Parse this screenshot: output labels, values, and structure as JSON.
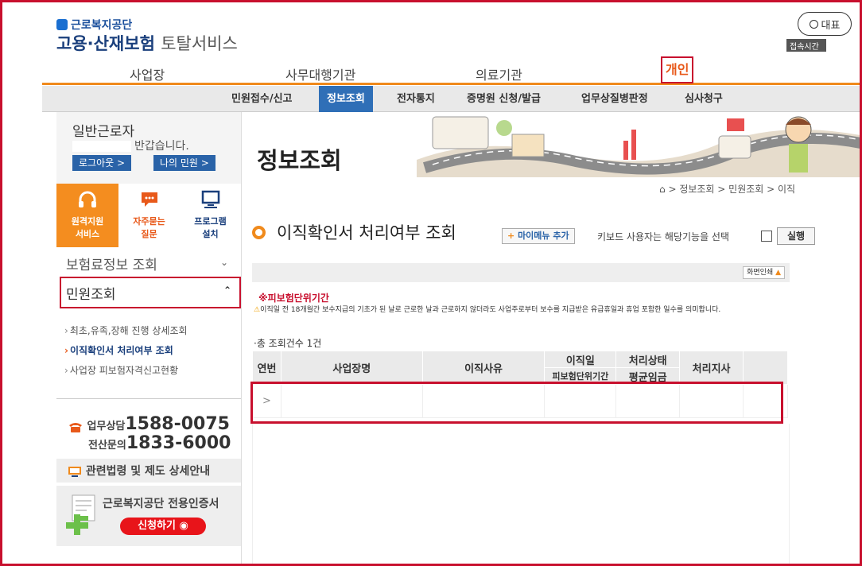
{
  "header": {
    "org_name": "근로복지공단",
    "service_title_bold": "고용·산재보험",
    "service_title_light": "토탈서비스",
    "rep_button": "대표",
    "access_badge": "접속시간"
  },
  "top_nav": [
    "사업장",
    "사무대행기관",
    "의료기관",
    "개인"
  ],
  "sub_nav": [
    "민원접수/신고",
    "정보조회",
    "전자통지",
    "증명원 신청/발급",
    "업무상질병판정",
    "심사청구"
  ],
  "user": {
    "type": "일반근로자",
    "greeting": "반갑습니다.",
    "logout": "로그아웃 >",
    "my_civil": "나의 민원 >"
  },
  "quick_links": [
    {
      "line1": "원격지원",
      "line2": "서비스"
    },
    {
      "line1": "자주묻는",
      "line2": "질문"
    },
    {
      "line1": "프로그램",
      "line2": "설치"
    }
  ],
  "side_menu": {
    "insurance_info": "보험료정보 조회",
    "civil_inquiry": "민원조회",
    "items": [
      "최초,유족,장해 진행 상세조회",
      "이직확인서 처리여부 조회",
      "사업장 피보험자격신고현황"
    ]
  },
  "contact": {
    "consult_label": "업무상담",
    "consult_number": "1588-0075",
    "it_label": "전산문의",
    "it_number": "1833-6000",
    "law_link": "관련법령 및 제도 상세안내",
    "cert_title": "근로복지공단 전용인증서",
    "cert_button": "신청하기"
  },
  "main": {
    "page_title": "정보조회",
    "breadcrumb": "정보조회 > 민원조회 > 이직",
    "section_title": "이직확인서 처리여부 조회",
    "mymenu_button": "마이메뉴 추가",
    "keyboard_text": "키보드 사용자는 해당기능을 선택",
    "exec_button": "실행",
    "print_button": "화면인쇄",
    "notice_title": "※피보험단위기간",
    "notice_text": "이직일 전 18개월간 보수지급의 기초가 된 날로 근로한 날과 근로하지 않더라도 사업주로부터 보수를 지급받은 유급휴일과 휴업 포함한 일수를 의미합니다.",
    "count_text": "총 조회건수 1건",
    "table": {
      "headers": [
        "연번",
        "사업장명",
        "이직사유",
        "이직일",
        "피보험단위기간",
        "처리상태",
        "평균임금",
        "처리지사"
      ],
      "rows": [
        [
          ">",
          "",
          "",
          "",
          "",
          ""
        ]
      ]
    }
  },
  "colors": {
    "accent": "#f08a1c",
    "brand_blue": "#2f6fb7",
    "highlight_red": "#c8102e"
  }
}
